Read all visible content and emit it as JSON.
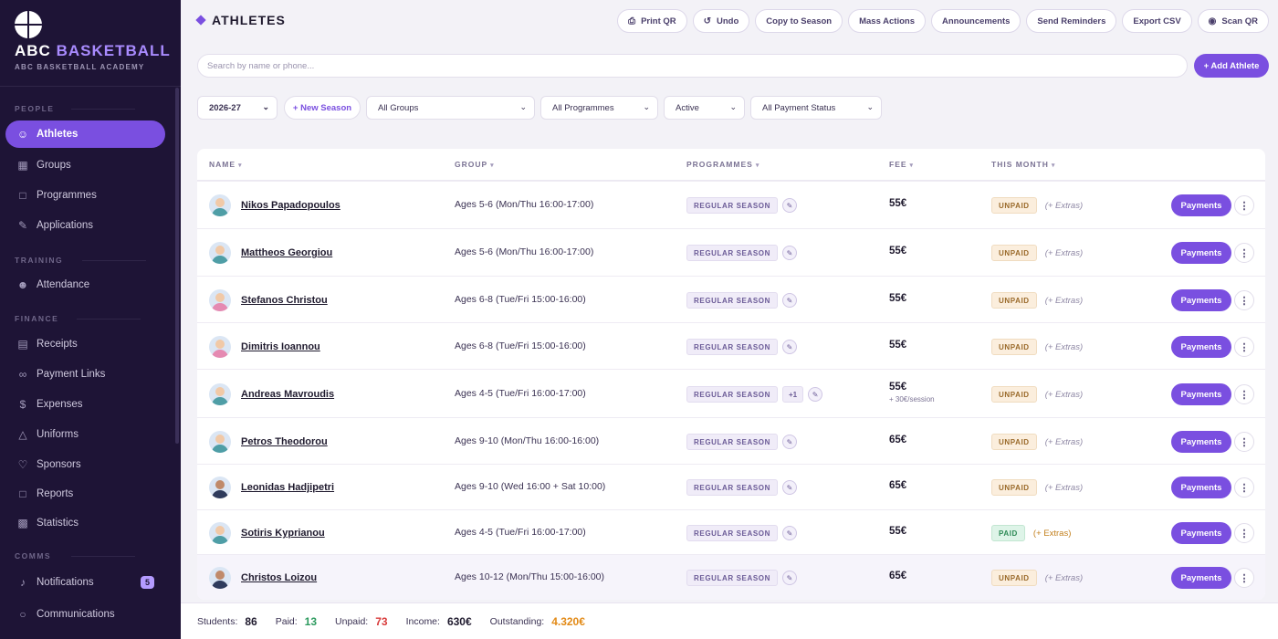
{
  "brand": {
    "title_main": "ABC",
    "title_accent": "BASKETBALL",
    "subtitle": "ABC BASKETBALL ACADEMY"
  },
  "sidebar": {
    "sections": [
      {
        "label": "PEOPLE"
      },
      {
        "label": "TRAINING"
      },
      {
        "label": "FINANCE"
      },
      {
        "label": "COMMS"
      }
    ],
    "items": [
      {
        "label": "Athletes",
        "icon": "users-icon"
      },
      {
        "label": "Groups",
        "icon": "grid-icon"
      },
      {
        "label": "Programmes",
        "icon": "book-icon"
      },
      {
        "label": "Applications",
        "icon": "edit-icon"
      },
      {
        "label": "Attendance",
        "icon": "user-check-icon"
      },
      {
        "label": "Receipts",
        "icon": "receipt-icon"
      },
      {
        "label": "Payment Links",
        "icon": "link-icon"
      },
      {
        "label": "Expenses",
        "icon": "dollar-icon"
      },
      {
        "label": "Uniforms",
        "icon": "shirt-icon"
      },
      {
        "label": "Sponsors",
        "icon": "heart-icon"
      },
      {
        "label": "Reports",
        "icon": "file-icon"
      },
      {
        "label": "Statistics",
        "icon": "bar-chart-icon"
      },
      {
        "label": "Notifications",
        "icon": "bell-icon",
        "badge": "5"
      },
      {
        "label": "Communications",
        "icon": "chat-icon"
      }
    ]
  },
  "header": {
    "title": "ATHLETES",
    "toolbar": [
      {
        "label": "Print QR",
        "icon": "printer-icon"
      },
      {
        "label": "Undo",
        "icon": "undo-icon"
      },
      {
        "label": "Copy to Season",
        "icon": ""
      },
      {
        "label": "Mass Actions",
        "icon": ""
      },
      {
        "label": "Announcements",
        "icon": ""
      },
      {
        "label": "Send Reminders",
        "icon": ""
      },
      {
        "label": "Export CSV",
        "icon": ""
      },
      {
        "label": "Scan QR",
        "icon": "camera-icon"
      }
    ]
  },
  "search": {
    "placeholder": "Search by name or phone...",
    "add_label": "+ Add Athlete"
  },
  "filters": {
    "season": "2026-27",
    "new_season_label": "+ New Season",
    "groups": "All Groups",
    "programmes": "All Programmes",
    "status": "Active",
    "payment_status": "All Payment Status"
  },
  "table": {
    "columns": [
      "NAME",
      "GROUP",
      "PROGRAMMES",
      "FEE",
      "THIS MONTH"
    ],
    "rows": [
      {
        "name": "Nikos Papadopoulos",
        "group": "Ages 5-6 (Mon/Thu 16:00-17:00)",
        "programme": "REGULAR SEASON",
        "extra_prog": "",
        "fee": "55€",
        "fee_note": "",
        "status": "UNPAID",
        "extras": "(+ Extras)",
        "avatar": "m",
        "payments_label": "Payments"
      },
      {
        "name": "Mattheos Georgiou",
        "group": "Ages 5-6 (Mon/Thu 16:00-17:00)",
        "programme": "REGULAR SEASON",
        "extra_prog": "",
        "fee": "55€",
        "fee_note": "",
        "status": "UNPAID",
        "extras": "(+ Extras)",
        "avatar": "m",
        "payments_label": "Payments"
      },
      {
        "name": "Stefanos Christou",
        "group": "Ages 6-8 (Tue/Fri 15:00-16:00)",
        "programme": "REGULAR SEASON",
        "extra_prog": "",
        "fee": "55€",
        "fee_note": "",
        "status": "UNPAID",
        "extras": "(+ Extras)",
        "avatar": "f",
        "payments_label": "Payments"
      },
      {
        "name": "Dimitris Ioannou",
        "group": "Ages 6-8 (Tue/Fri 15:00-16:00)",
        "programme": "REGULAR SEASON",
        "extra_prog": "",
        "fee": "55€",
        "fee_note": "",
        "status": "UNPAID",
        "extras": "(+ Extras)",
        "avatar": "f",
        "payments_label": "Payments"
      },
      {
        "name": "Andreas Mavroudis",
        "group": "Ages 4-5 (Tue/Fri 16:00-17:00)",
        "programme": "REGULAR SEASON",
        "extra_prog": "+1",
        "fee": "55€",
        "fee_note": "+ 30€/session",
        "status": "UNPAID",
        "extras": "(+ Extras)",
        "avatar": "m",
        "payments_label": "Payments"
      },
      {
        "name": "Petros Theodorou",
        "group": "Ages 9-10 (Mon/Thu 16:00-16:00)",
        "programme": "REGULAR SEASON",
        "extra_prog": "",
        "fee": "65€",
        "fee_note": "",
        "status": "UNPAID",
        "extras": "(+ Extras)",
        "avatar": "m",
        "payments_label": "Payments"
      },
      {
        "name": "Leonidas Hadjipetri",
        "group": "Ages 9-10 (Wed 16:00 + Sat 10:00)",
        "programme": "REGULAR SEASON",
        "extra_prog": "",
        "fee": "65€",
        "fee_note": "",
        "status": "UNPAID",
        "extras": "(+ Extras)",
        "avatar": "d",
        "payments_label": "Payments"
      },
      {
        "name": "Sotiris Kyprianou",
        "group": "Ages 4-5 (Tue/Fri 16:00-17:00)",
        "programme": "REGULAR SEASON",
        "extra_prog": "",
        "fee": "55€",
        "fee_note": "",
        "status": "PAID",
        "extras": "(+ Extras)",
        "avatar": "m",
        "payments_label": "Payments"
      },
      {
        "name": "Christos Loizou",
        "group": "Ages 10-12 (Mon/Thu 15:00-16:00)",
        "programme": "REGULAR SEASON",
        "extra_prog": "",
        "fee": "65€",
        "fee_note": "",
        "status": "UNPAID",
        "extras": "(+ Extras)",
        "avatar": "d",
        "payments_label": "Payments"
      }
    ]
  },
  "footer": {
    "students_label": "Students:",
    "students": "86",
    "paid_label": "Paid:",
    "paid": "13",
    "unpaid_label": "Unpaid:",
    "unpaid": "73",
    "income_label": "Income:",
    "income": "630€",
    "outstanding_label": "Outstanding:",
    "outstanding": "4.320€"
  },
  "colors": {
    "accent": "#7a4fe0",
    "sidebar_bg": "#1e1436",
    "paid_green": "#2c9a5e",
    "unpaid_red": "#d83a3a",
    "outstanding_orange": "#e28a16"
  }
}
